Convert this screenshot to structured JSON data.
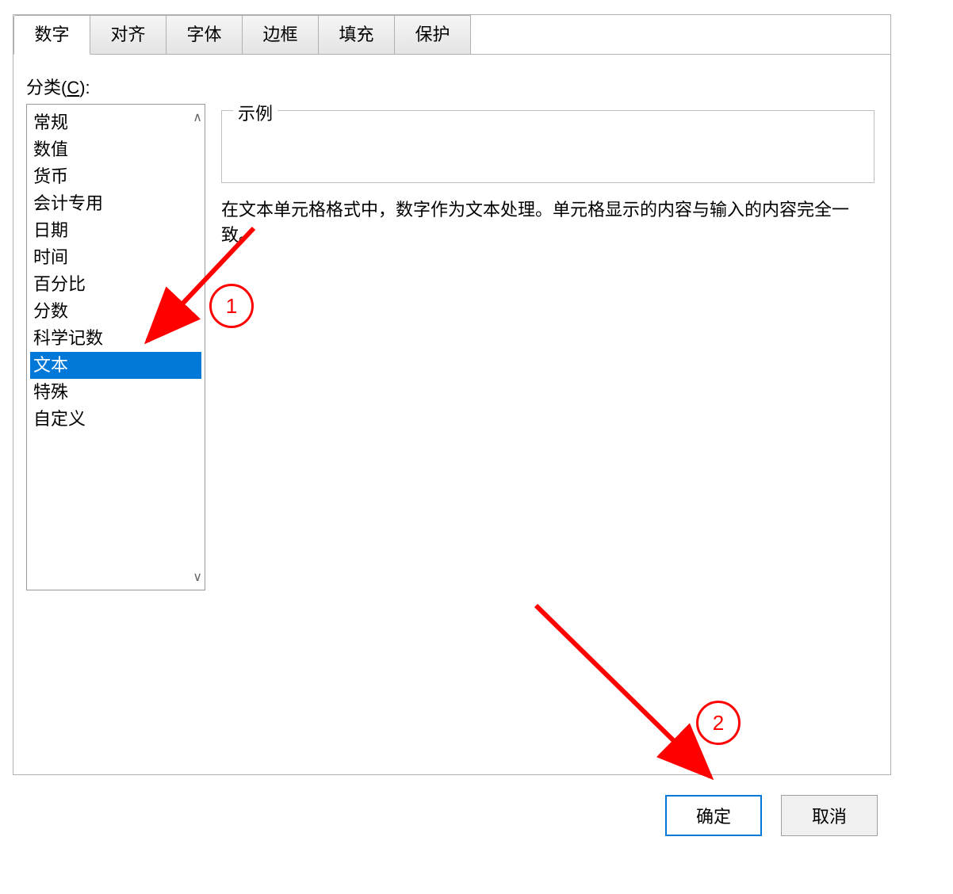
{
  "tabs": [
    {
      "label": "数字",
      "active": true
    },
    {
      "label": "对齐",
      "active": false
    },
    {
      "label": "字体",
      "active": false
    },
    {
      "label": "边框",
      "active": false
    },
    {
      "label": "填充",
      "active": false
    },
    {
      "label": "保护",
      "active": false
    }
  ],
  "category_label_prefix": "分类(",
  "category_label_hotkey": "C",
  "category_label_suffix": "):",
  "categories": [
    "常规",
    "数值",
    "货币",
    "会计专用",
    "日期",
    "时间",
    "百分比",
    "分数",
    "科学记数",
    "文本",
    "特殊",
    "自定义"
  ],
  "selected_category_index": 9,
  "sample_label": "示例",
  "description": "在文本单元格格式中，数字作为文本处理。单元格显示的内容与输入的内容完全一致。",
  "buttons": {
    "ok": "确定",
    "cancel": "取消"
  },
  "annotations": {
    "marker1": "1",
    "marker2": "2"
  }
}
